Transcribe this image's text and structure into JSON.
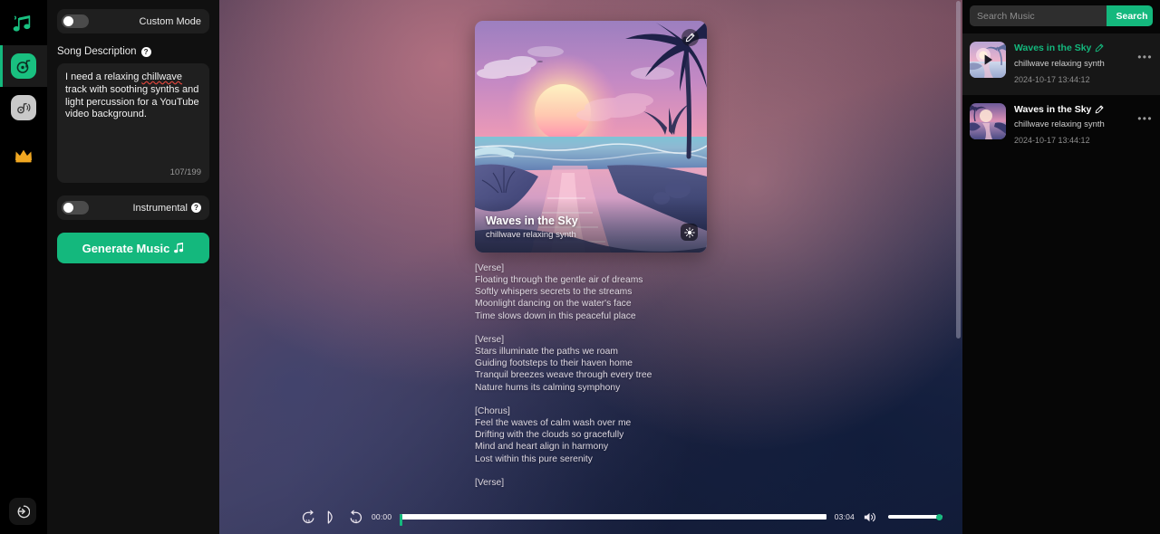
{
  "rail": {
    "logo_icon": "music-notes-logo",
    "items": [
      {
        "name": "create-music",
        "icon": "music-disc-icon",
        "active": true
      },
      {
        "name": "library",
        "icon": "music-waves-icon",
        "active": false
      }
    ],
    "crown_icon": "crown-icon",
    "exit_icon": "exit-arrow-icon"
  },
  "left_panel": {
    "custom_mode": {
      "label": "Custom Mode",
      "enabled": false
    },
    "song_description": {
      "label": "Song Description",
      "help_icon": "question-mark-icon",
      "value": "I need a relaxing chillwave track with soothing synths and light percussion for a YouTube video background.",
      "misspelled_word": "chillwave",
      "counter": "107/199"
    },
    "instrumental": {
      "label": "Instrumental",
      "enabled": false,
      "help_icon": "question-mark-icon"
    },
    "generate_button": {
      "label": "Generate Music",
      "icon": "music-note-icon"
    }
  },
  "main": {
    "artwork": {
      "title": "Waves in the Sky",
      "subtitle": "chillwave relaxing synth",
      "edit_icon": "pencil-edit-icon",
      "sparkle_icon": "sparkle-icon",
      "alt": "pink sunset over tropical beach with palm tree"
    },
    "lyrics": "[Verse]\nFloating through the gentle air of dreams\nSoftly whispers secrets to the streams\nMoonlight dancing on the water's face\nTime slows down in this peaceful place\n\n[Verse]\nStars illuminate the paths we roam\nGuiding footsteps to their haven home\nTranquil breezes weave through every tree\nNature hums its calming symphony\n\n[Chorus]\nFeel the waves of calm wash over me\nDrifting with the clouds so gracefully\nMind and heart align in harmony\nLost within this pure serenity\n\n[Verse]"
  },
  "player": {
    "rewind_icon": "rewind-15-icon",
    "rewind_label": "15",
    "play_icon": "play-icon",
    "forward_icon": "forward-15-icon",
    "forward_label": "15",
    "current_time": "00:00",
    "total_time": "03:04",
    "progress_percent": 0,
    "volume_icon": "volume-icon",
    "volume_percent": 100
  },
  "right_panel": {
    "search": {
      "placeholder": "Search Music",
      "value": "",
      "button_label": "Search",
      "icon": "search-icon"
    },
    "tracks": [
      {
        "title": "Waves in the Sky",
        "subtitle": "chillwave relaxing synth",
        "date": "2024-10-17 13:44:12",
        "active": true,
        "edit_icon": "pencil-edit-icon",
        "menu_icon": "more-options-icon",
        "menu_glyph": "•••"
      },
      {
        "title": "Waves in the Sky",
        "subtitle": "chillwave relaxing synth",
        "date": "2024-10-17 13:44:12",
        "active": false,
        "edit_icon": "pencil-edit-icon",
        "menu_icon": "more-options-icon",
        "menu_glyph": "•••"
      }
    ]
  },
  "colors": {
    "accent_green": "#14b87d",
    "crown_gold": "#f0a721",
    "panel_dark": "#101010",
    "rail_black": "#000000"
  }
}
